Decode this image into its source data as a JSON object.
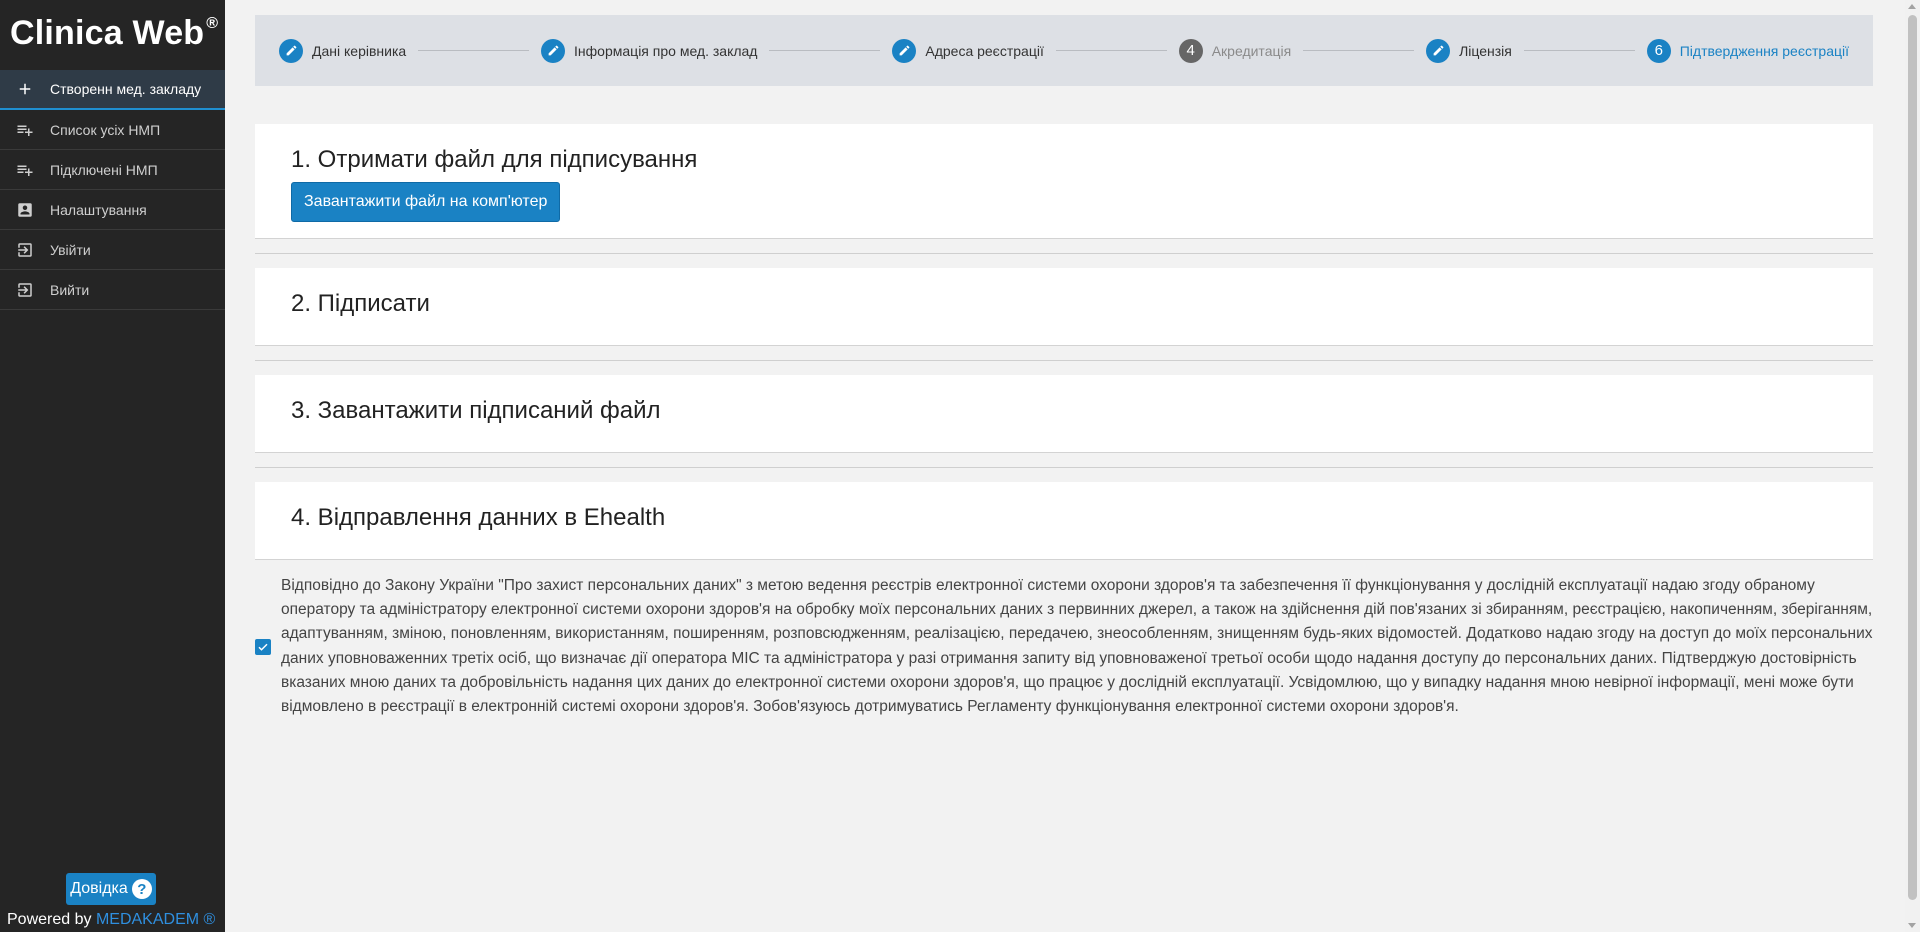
{
  "brand": {
    "name": "Clinica Web",
    "mark": "®"
  },
  "sidebar": {
    "items": [
      {
        "label": "Створенн мед. закладу",
        "icon": "plus-icon"
      },
      {
        "label": "Список усіх НМП",
        "icon": "playlist-add-icon"
      },
      {
        "label": "Підключені НМП",
        "icon": "playlist-add-icon"
      },
      {
        "label": "Налаштування",
        "icon": "account-box-icon"
      },
      {
        "label": "Увійти",
        "icon": "login-icon"
      },
      {
        "label": "Вийти",
        "icon": "login-icon"
      }
    ],
    "help_label": "Довідка",
    "help_icon_glyph": "?",
    "powered_by": "Powered by",
    "powered_link": "MEDAKADEM ®"
  },
  "stepper": {
    "steps": [
      {
        "label": "Дані керівника",
        "state": "done",
        "marker": ""
      },
      {
        "label": "Інформація про мед. заклад",
        "state": "done",
        "marker": ""
      },
      {
        "label": "Адреса реєстрації",
        "state": "done",
        "marker": ""
      },
      {
        "label": "Акредитація",
        "state": "disabled",
        "marker": "4"
      },
      {
        "label": "Ліцензія",
        "state": "done",
        "marker": ""
      },
      {
        "label": "Підтвердження реєстрації",
        "state": "current",
        "marker": "6"
      }
    ]
  },
  "sections": {
    "s1_title": "1. Отримати файл для підписування",
    "s1_button": "Завантажити файл на комп'ютер",
    "s2_title": "2. Підписати",
    "s3_title": "3. Завантажити підписаний файл",
    "s4_title": "4. Відправлення данних в Ehealth"
  },
  "consent": {
    "checked": true,
    "text": "Відповідно до Закону України \"Про захист персональних даних\" з метою ведення реєстрів електронної системи охорони здоров'я та забезпечення її функціонування у дослідній експлуатації надаю згоду обраному оператору та адміністратору електронної системи охорони здоров'я на обробку моїх персональних даних з первинних джерел, а також на здійснення дій пов'язаних зі збиранням, реєстрацією, накопиченням, зберіганням, адаптуванням, зміною, поновленням, використанням, поширенням, розповсюдженням, реалізацією, передачею, знеособленням, знищенням будь-яких відомостей. Додатково надаю згоду на доступ до моїх персональних даних уповноваженних третіх осіб, що визначає дії оператора МІС та адміністратора у разі отримання запиту від уповноваженої третьої особи щодо надання доступу до персональних даних. Підтверджую достовірність вказаних мною даних та добровільність надання цих даних до електронної системи охорони здоров'я, що працює у дослідній експлуатації. Усвідомлюю, що у випадку надання мною невірної інформації, мені може бути відмовлено в реєстрації в електронній системі охорони здоров'я. Зобов'язуюсь дотримуватись Регламенту функціонування електронної системи охорони здоров'я."
  },
  "colors": {
    "sidebar_bg": "#252525",
    "accent": "#1a82c4",
    "page_bg": "#f2f2f2",
    "stepper_bg": "#dde0e5"
  }
}
